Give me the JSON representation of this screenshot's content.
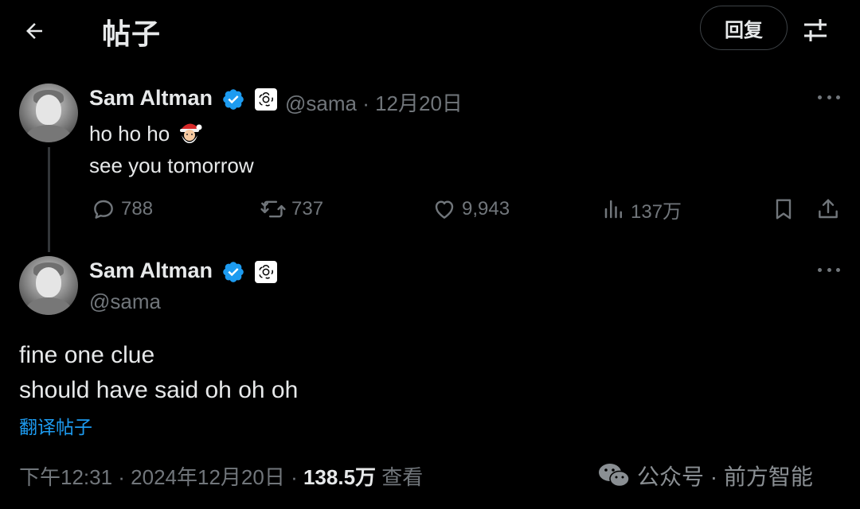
{
  "topbar": {
    "back_icon": "back-arrow-icon",
    "title": "帖子",
    "reply_label": "回复",
    "settings_icon": "tune-icon"
  },
  "tweet1": {
    "name": "Sam Altman",
    "handle_date": "@sama · 12月20日",
    "text_line1": "ho ho ho",
    "text_line2": "see you tomorrow",
    "emoji": "santa-emoji",
    "stats": {
      "replies": "788",
      "retweets": "737",
      "likes": "9,943",
      "views": "137万"
    }
  },
  "tweet2": {
    "name": "Sam Altman",
    "handle": "@sama",
    "text_line1": "fine one clue",
    "text_line2": "should have said oh oh oh",
    "translate": "翻译帖子",
    "timestamp": "下午12:31 · 2024年12月20日 · ",
    "views_count": "138.5万",
    "views_label": " 查看"
  },
  "watermark": {
    "text": "公众号 · 前方智能",
    "icon": "wechat-icon"
  },
  "colors": {
    "background": "#000000",
    "text": "#e7e9ea",
    "muted": "#71767b",
    "link": "#1d9bf0",
    "verified": "#1d9bf0"
  }
}
